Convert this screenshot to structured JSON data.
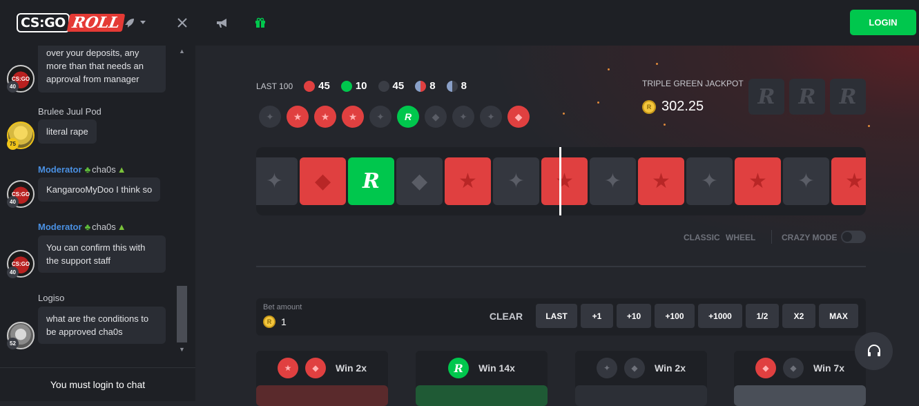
{
  "header": {
    "logo_left": "CS:GO",
    "logo_right": "ROLL",
    "nav_icons": [
      "rocket-icon",
      "swords-icon",
      "megaphone-icon",
      "gift-icon"
    ],
    "login_label": "LOGIN"
  },
  "chat": {
    "messages": [
      {
        "name": "",
        "text": "over your deposits, any more than that needs an approval from manager",
        "level": "40",
        "moderator": false
      },
      {
        "name": "Brulee Juul Pod",
        "text": "literal rape",
        "level": "75",
        "moderator": false
      },
      {
        "name": "Moderator",
        "user": "cha0s",
        "text": "KangarooMyDoo I think so",
        "level": "40",
        "moderator": true
      },
      {
        "name": "Moderator",
        "user": "cha0s",
        "text": "You can confirm this with the support staff",
        "level": "40",
        "moderator": true
      },
      {
        "name": "Logiso",
        "text": "what are the conditions to be approved cha0s",
        "level": "52",
        "moderator": false
      }
    ],
    "footer": "You must login to chat"
  },
  "stats": {
    "label": "LAST 100",
    "red": "45",
    "green": "10",
    "dark": "45",
    "bonus_red": "8",
    "bonus_dark": "8"
  },
  "history": [
    "t",
    "ct",
    "ct",
    "ct",
    "t",
    "g",
    "tfish",
    "t",
    "t",
    "ctfish"
  ],
  "jackpot": {
    "label": "TRIPLE GREEN JACKPOT",
    "amount": "302.25"
  },
  "roll_tiles": [
    "t",
    "fish",
    "g",
    "tfish",
    "ct",
    "t",
    "ct",
    "t",
    "ct",
    "t",
    "ct",
    "t",
    "ct"
  ],
  "modes": {
    "classic": "CLASSIC",
    "wheel": "WHEEL",
    "crazy": "CRAZY MODE"
  },
  "bet": {
    "label": "Bet amount",
    "value": "1",
    "clear": "CLEAR",
    "buttons": [
      "LAST",
      "+1",
      "+10",
      "+100",
      "+1000",
      "1/2",
      "X2",
      "MAX"
    ]
  },
  "columns": [
    {
      "label": "Win 2x",
      "bar_color": "#5a2a2c"
    },
    {
      "label": "Win 14x",
      "bar_color": "#1f5a35"
    },
    {
      "label": "Win 2x",
      "bar_color": "#2c2f36"
    },
    {
      "label": "Win 7x",
      "bar_color": "#4a4f58"
    }
  ]
}
